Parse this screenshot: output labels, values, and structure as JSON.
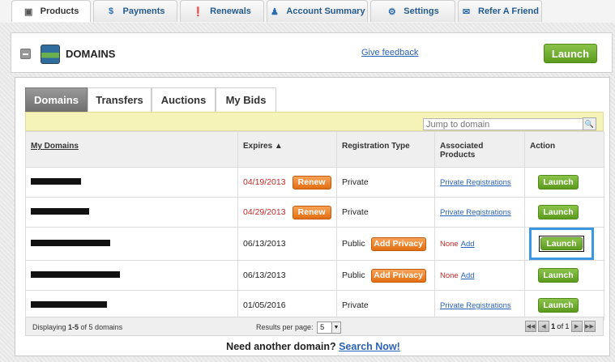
{
  "top_tabs": [
    {
      "label": "Products",
      "icon": "box-icon",
      "active": true
    },
    {
      "label": "Payments",
      "icon": "dollar-icon",
      "active": false
    },
    {
      "label": "Renewals",
      "icon": "alert-icon",
      "active": false
    },
    {
      "label": "Account Summary",
      "icon": "user-icon",
      "active": false
    },
    {
      "label": "Settings",
      "icon": "gear-icon",
      "active": false
    },
    {
      "label": "Refer A Friend",
      "icon": "speech-bubble-icon",
      "active": false
    }
  ],
  "header": {
    "title": "DOMAINS",
    "feedback_link": "Give feedback",
    "launch_label": "Launch"
  },
  "sub_tabs": [
    {
      "label": "Domains",
      "active": true
    },
    {
      "label": "Transfers",
      "active": false
    },
    {
      "label": "Auctions",
      "active": false
    },
    {
      "label": "My Bids",
      "active": false
    }
  ],
  "search": {
    "placeholder": "Jump to domain"
  },
  "table": {
    "columns": [
      "My Domains",
      "Expires ▲",
      "Registration Type",
      "Associated Products",
      "Action"
    ],
    "rows": [
      {
        "expires": "04/19/2013",
        "expiring": true,
        "renew_label": "Renew",
        "reg_type": "Private",
        "privacy_label": "",
        "product": "Private Registrations",
        "none": "",
        "add": "",
        "action": "Launch"
      },
      {
        "expires": "04/29/2013",
        "expiring": true,
        "renew_label": "Renew",
        "reg_type": "Private",
        "privacy_label": "",
        "product": "Private Registrations",
        "none": "",
        "add": "",
        "action": "Launch"
      },
      {
        "expires": "06/13/2013",
        "expiring": false,
        "renew_label": "",
        "reg_type": "Public",
        "privacy_label": "Add Privacy",
        "product": "",
        "none": "None",
        "add": "Add",
        "action": "Launch"
      },
      {
        "expires": "06/13/2013",
        "expiring": false,
        "renew_label": "",
        "reg_type": "Public",
        "privacy_label": "Add Privacy",
        "product": "",
        "none": "None",
        "add": "Add",
        "action": "Launch"
      },
      {
        "expires": "01/05/2016",
        "expiring": false,
        "renew_label": "",
        "reg_type": "Private",
        "privacy_label": "",
        "product": "Private Registrations",
        "none": "",
        "add": "",
        "action": "Launch"
      }
    ]
  },
  "footer": {
    "displaying_prefix": "Displaying ",
    "displaying_range": "1-5",
    "displaying_suffix": " of 5 domains",
    "results_label": "Results per page:",
    "results_value": "5",
    "page_current": "1",
    "page_of": "of",
    "page_total": "1"
  },
  "bottom": {
    "question": "Need another domain?",
    "link": "Search Now!"
  },
  "colors": {
    "accent_green": "#6aa52a",
    "renew_orange": "#e87a1f",
    "link_blue": "#2a62b8",
    "expiring_red": "#c62828",
    "focus_blue": "#3a97e0"
  }
}
